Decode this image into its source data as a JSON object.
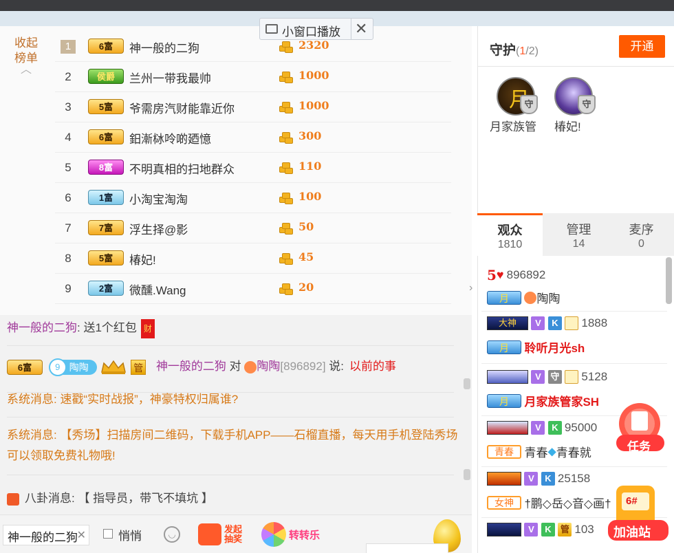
{
  "mini_player": {
    "label": "小窗口播放",
    "close": "✕"
  },
  "rank_panel": {
    "collapse_label": "收起榜单",
    "rows": [
      {
        "rank": "1",
        "badge": "6富",
        "name": "神一般的二狗",
        "amount": "2320"
      },
      {
        "rank": "2",
        "badge": "侯爵",
        "name": "兰州一带我最帅",
        "amount": "1000"
      },
      {
        "rank": "3",
        "badge": "5富",
        "name": "爷需房汽财能靠近你",
        "amount": "1000"
      },
      {
        "rank": "4",
        "badge": "6富",
        "name": "鈤漸栤呤啲廼憶",
        "amount": "300"
      },
      {
        "rank": "5",
        "badge": "8富",
        "name": "不明真相的扫地群众",
        "amount": "110"
      },
      {
        "rank": "6",
        "badge": "1富",
        "name": "小淘宝淘淘",
        "amount": "100"
      },
      {
        "rank": "7",
        "badge": "7富",
        "name": "浮生择@影",
        "amount": "50"
      },
      {
        "rank": "8",
        "badge": "5富",
        "name": "椿妃!",
        "amount": "45"
      },
      {
        "rank": "9",
        "badge": "2富",
        "name": "微醺.Wang",
        "amount": "20"
      }
    ]
  },
  "chat": {
    "msg1": {
      "user": "神一般的二狗",
      "text": ": 送1个红包",
      "icon": "财"
    },
    "msg2": {
      "badge": "6富",
      "fan_level": "9",
      "fan_name": "陶陶",
      "guan": "管",
      "user": "神一般的二狗",
      "to": " 对 ",
      "target": "陶陶",
      "target_id": "[896892]",
      "says": " 说:",
      "text": "以前的事"
    },
    "sys1": "系统消息: 速戳“实时战报”，神豪特权归属谁?",
    "sys2": "系统消息: 【秀场】扫描房间二维码，下载手机APP——石榴直播，每天用手机登陆秀场可以领取免费礼物哦!",
    "gossip": "八卦消息: 【 指导员，带飞不填坑 】"
  },
  "input_bar": {
    "input_value": "神一般的二狗",
    "quiet_label": "悄悄",
    "lottery_label": "发起抽奖",
    "wheel_label": "转转乐"
  },
  "guard": {
    "title": "守护",
    "count_current": "1",
    "count_total": "/2)",
    "count_open": "(",
    "open_button": "开通",
    "members": [
      {
        "name": "月家族管",
        "avatar_text": "月",
        "shield": "守"
      },
      {
        "name": "椿妃!",
        "avatar_text": "",
        "shield": "守"
      }
    ]
  },
  "tabs": [
    {
      "label": "观众",
      "count": "1810"
    },
    {
      "label": "管理",
      "count": "14"
    },
    {
      "label": "麦序",
      "count": "0"
    }
  ],
  "audience": [
    {
      "level": "5",
      "id": "896892",
      "tag": "月",
      "name": "陶陶"
    },
    {
      "level_icon": "大神",
      "v": "V",
      "k": "K",
      "id": "1888",
      "tag": "月",
      "name": "聆听月光sh"
    },
    {
      "level_icon": "",
      "v": "V",
      "g": "守",
      "id": "5128",
      "tag": "月",
      "name": "月家族管家SH"
    },
    {
      "level_icon": "",
      "v": "V",
      "k": "K",
      "id": "95000",
      "tag": "青春",
      "name": "青春",
      "name2": "青春就"
    },
    {
      "level_icon": "",
      "v": "V",
      "k": "K",
      "id": "25158",
      "tag": "女神",
      "name": "†鹏◇岳◇音◇画†"
    },
    {
      "level_icon": "",
      "v": "V",
      "k": "K",
      "g": "管",
      "id": "103"
    }
  ],
  "floating": {
    "task_label": "任务",
    "oil_label": "加油站",
    "oil_num": "6#"
  },
  "colors": {
    "accent": "#ff5a00",
    "coin": "#ef7d1c",
    "system": "#d77a18",
    "user_link": "#a0399a"
  }
}
